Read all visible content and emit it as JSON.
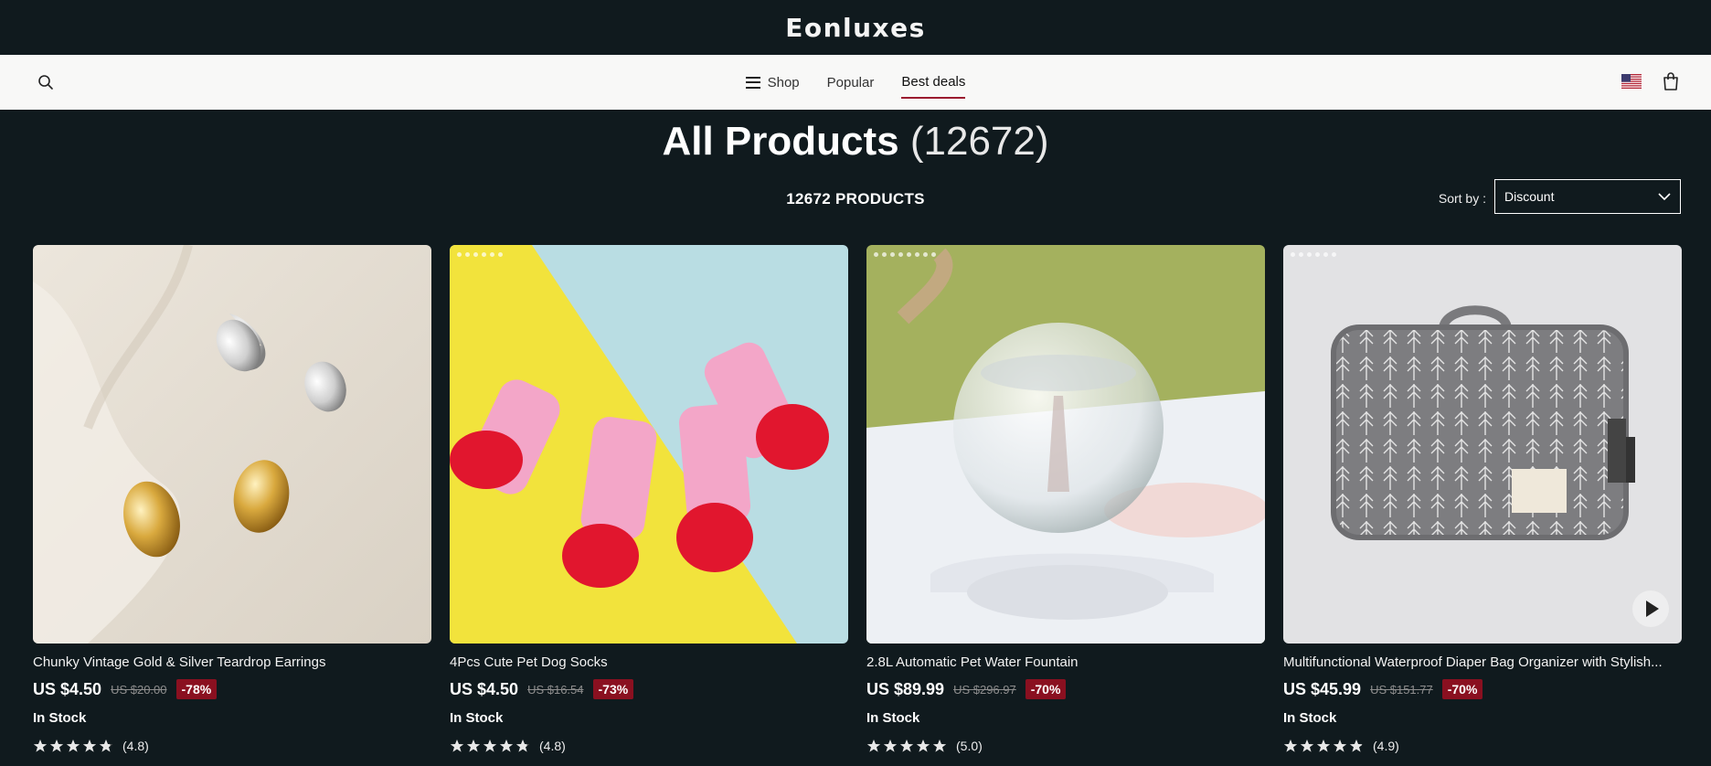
{
  "brand": {
    "name": "Eonluxes"
  },
  "nav": {
    "items": [
      {
        "label": "Shop"
      },
      {
        "label": "Popular"
      },
      {
        "label": "Best deals"
      }
    ]
  },
  "page": {
    "title_main": "All Products",
    "title_count": "(12672)",
    "products_count": "12672 PRODUCTS",
    "sort_label": "Sort by :",
    "sort_value": "Discount"
  },
  "products": [
    {
      "name": "Chunky Vintage Gold & Silver Teardrop Earrings",
      "price": "US $4.50",
      "old_price": "US $20.00",
      "discount": "-78%",
      "stock": "In Stock",
      "rating": "(4.8)",
      "stars": 4.8
    },
    {
      "name": "4Pcs Cute Pet Dog Socks",
      "price": "US $4.50",
      "old_price": "US $16.54",
      "discount": "-73%",
      "stock": "In Stock",
      "rating": "(4.8)",
      "stars": 4.8
    },
    {
      "name": "2.8L Automatic Pet Water Fountain",
      "price": "US $89.99",
      "old_price": "US $296.97",
      "discount": "-70%",
      "stock": "In Stock",
      "rating": "(5.0)",
      "stars": 5.0
    },
    {
      "name": "Multifunctional Waterproof Diaper Bag Organizer with Stylish...",
      "price": "US $45.99",
      "old_price": "US $151.77",
      "discount": "-70%",
      "stock": "In Stock",
      "rating": "(4.9)",
      "stars": 4.9
    }
  ],
  "colors": {
    "background": "#101a1e",
    "navbar": "#f8f8f7",
    "discount": "#8a1020",
    "active_underline": "#9b1b30"
  }
}
